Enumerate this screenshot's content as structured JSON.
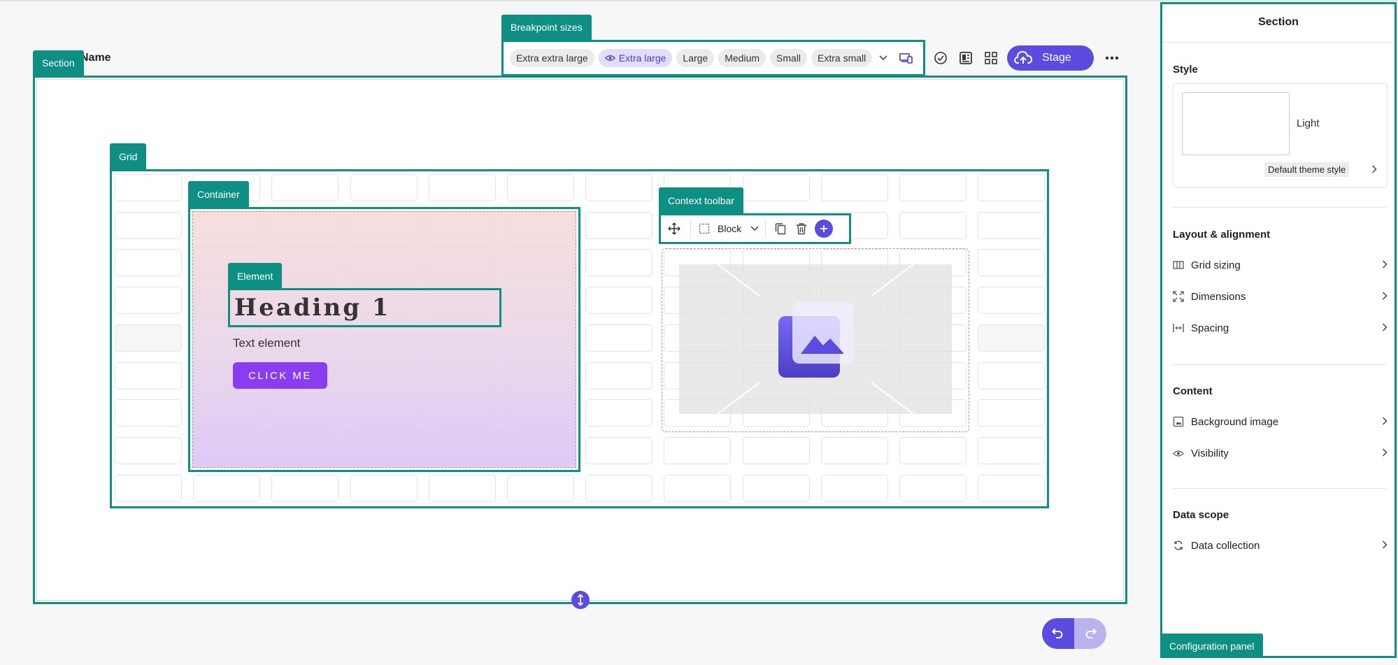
{
  "page": {
    "name_fragment": "Name"
  },
  "tags": {
    "section": "Section",
    "breakpoints": "Breakpoint sizes",
    "grid": "Grid",
    "container": "Container",
    "element": "Element",
    "context_toolbar": "Context toolbar",
    "config_panel": "Configuration panel"
  },
  "breakpoints": {
    "items": [
      "Extra extra large",
      "Extra large",
      "Large",
      "Medium",
      "Small",
      "Extra small"
    ],
    "active_index": 1
  },
  "toolbar": {
    "stage_label": "Stage"
  },
  "canvas": {
    "heading": "Heading 1",
    "text": "Text element",
    "button": "CLICK ME"
  },
  "context_toolbar": {
    "block_label": "Block"
  },
  "panel": {
    "title": "Section",
    "style_header": "Style",
    "style_name": "Light",
    "theme_style": "Default theme style",
    "layout_header": "Layout & alignment",
    "layout_items": [
      "Grid sizing",
      "Dimensions",
      "Spacing"
    ],
    "content_header": "Content",
    "content_items": [
      "Background image",
      "Visibility"
    ],
    "data_header": "Data scope",
    "data_items": [
      "Data collection"
    ]
  },
  "colors": {
    "teal": "#0e8f84",
    "accent": "#5b4be0",
    "button_purple": "#8a3cf0"
  }
}
